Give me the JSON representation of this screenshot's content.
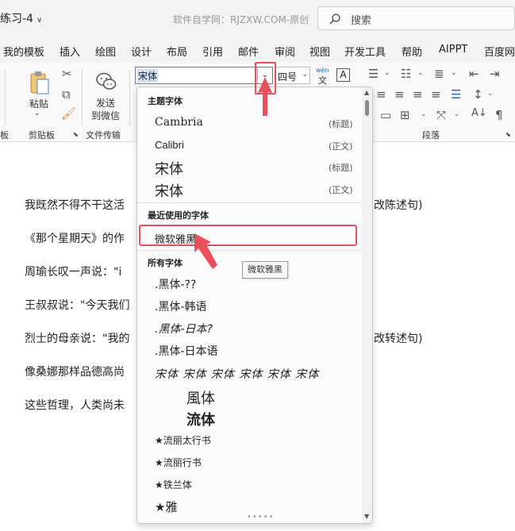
{
  "titlebar": {
    "doc_title": "练习-4",
    "watermark": "软件自学网：RJZXW.COM-原创",
    "search_placeholder": "搜索"
  },
  "menu": {
    "tabs": [
      "我的模板",
      "插入",
      "绘图",
      "设计",
      "布局",
      "引用",
      "邮件",
      "审阅",
      "视图",
      "开发工具",
      "帮助",
      "AIPPT",
      "百度网"
    ]
  },
  "ribbon": {
    "paste_label": "粘贴",
    "send_label_1": "发送",
    "send_label_2": "到微信",
    "group_clipboard": "剪贴板",
    "group_transfer": "文件传输",
    "group_paragraph": "段落",
    "group_left_partial": "板",
    "font_name": "宋体",
    "font_size": "四号",
    "wen_top": "wén",
    "wen_bottom": "文",
    "char_border": "A"
  },
  "document": {
    "lines": [
      {
        "left": "我既然不得不干这活",
        "right": "改陈述句)"
      },
      {
        "left": "《那个星期天》的作",
        "right": ""
      },
      {
        "left": "周瑜长叹一声说：\"i",
        "right": ""
      },
      {
        "left": "王叔叔说：\"今天我们",
        "right": ""
      },
      {
        "left": "烈士的母亲说：\"我的",
        "right": "改转述句)"
      },
      {
        "left": "像桑娜那样品德高尚",
        "right": ""
      },
      {
        "left": "这些哲理，人类尚未",
        "right": ""
      }
    ]
  },
  "dropdown": {
    "theme_header": "主题字体",
    "theme_fonts": [
      {
        "name": "Cambria",
        "tag": "(标题)"
      },
      {
        "name": "Calibri",
        "tag": "(正文)"
      },
      {
        "name": "宋体",
        "tag": "(标题)"
      },
      {
        "name": "宋体",
        "tag": "(正文)"
      }
    ],
    "recent_header": "最近使用的字体",
    "recent_fonts": [
      "微软雅黑"
    ],
    "all_header": "所有字体",
    "all_fonts": [
      ".黑体-??",
      ".黑体-韩语",
      ".黑体-日本?",
      ".黑体-日本语",
      "宋体 宋体 宋体 宋体 宋体 宋体",
      "風体",
      "流体",
      "★流丽太行书",
      "★流丽行书",
      "★铁兰体",
      "★雅"
    ],
    "tooltip": "微软雅黑"
  },
  "colors": {
    "annotation_red": "#e8505b",
    "selection_blue": "#cfe0f7"
  }
}
